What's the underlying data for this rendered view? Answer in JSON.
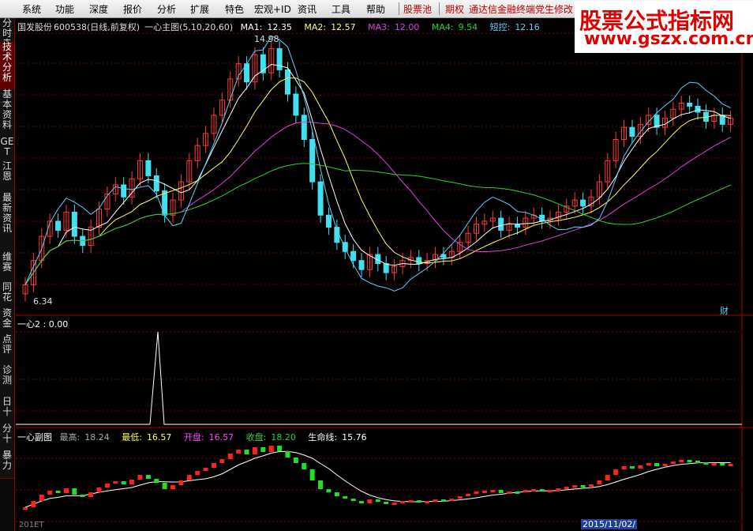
{
  "menu": {
    "items": [
      "系统",
      "功能",
      "深度",
      "报价",
      "分析",
      "扩展",
      "特色",
      "宏观+ID",
      "资讯",
      "工具",
      "帮助"
    ],
    "stock_pool": "股票池",
    "options": "期权",
    "marquee": "通达信金融终端党生修改"
  },
  "watermark": {
    "title": "股票公式指标网",
    "url": "www.gszx.com.cn"
  },
  "sidebar": {
    "tabs": [
      "分时走势",
      "技术分析",
      "基本资料",
      "GET",
      "江恩",
      "最新资讯",
      "维赛",
      "同花",
      "资金",
      "点评",
      "诊测",
      "日十",
      "分十",
      "暴力"
    ]
  },
  "main_panel": {
    "stock": "国发股份",
    "code": "600538",
    "period": "(日线,前复权)",
    "indicator": "一心主图(5,10,20,60)",
    "ma1_label": "MA1:",
    "ma1_value": "12.35",
    "ma2_label": "MA2:",
    "ma2_value": "12.57",
    "ma3_label": "MA3:",
    "ma3_value": "12.00",
    "ma4_label": "MA4:",
    "ma4_value": "9.54",
    "ctrl_label": "短控:",
    "ctrl_value": "12.16",
    "high_marker": "14.98",
    "low_marker": "6.34",
    "fin_badge": "财"
  },
  "panel2": {
    "title": "一心2 : 0.00"
  },
  "panel3": {
    "title": "一心副图",
    "high_label": "最高:",
    "high_value": "18.24",
    "low_label": "最低:",
    "low_value": "16.57",
    "open_label": "开盘:",
    "open_value": "16.57",
    "close_label": "收盘:",
    "close_value": "18.20",
    "life_label": "生命线:",
    "life_value": "15.76"
  },
  "axis": {
    "date_left": "201ET",
    "date_mid": "2015/11/02/"
  },
  "colors": {
    "up": "#ff3a3a",
    "down": "#40e0f0",
    "ma1": "#ffffff",
    "ma2": "#ffff60",
    "ma3": "#e040e0",
    "ma4": "#30d030",
    "ctrl": "#5fd0ff",
    "grid": "#8a0000"
  },
  "chart_data": {
    "type": "candlestick",
    "title": "",
    "price_range": [
      6.34,
      14.98
    ],
    "ma_values_last": {
      "MA1": 12.35,
      "MA2": 12.57,
      "MA3": 12.0,
      "MA4": 9.54,
      "短控": 12.16
    },
    "sub_chart_spike": 0.0
  }
}
